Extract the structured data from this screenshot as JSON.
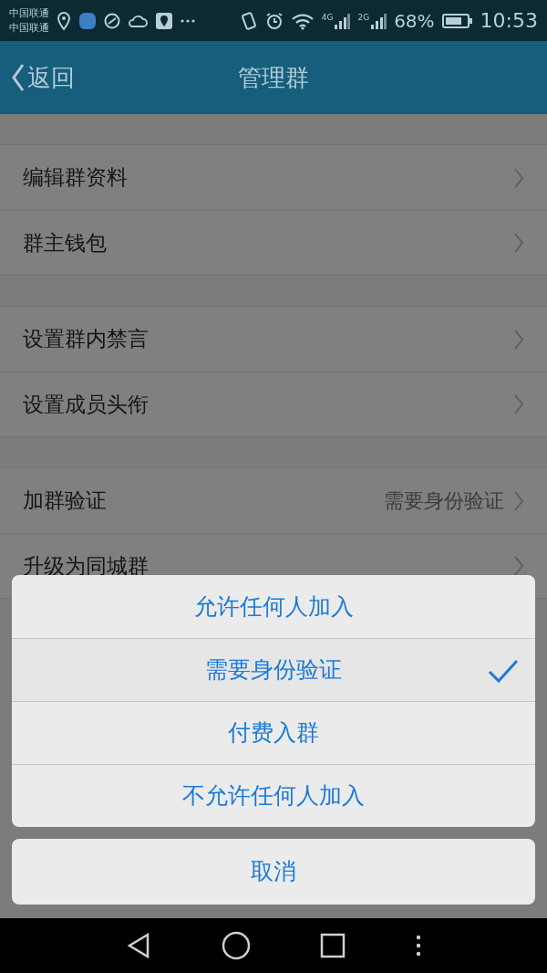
{
  "status_bar": {
    "carriers": [
      "中国联通",
      "中国联通"
    ],
    "network_labels": [
      "4G",
      "2G"
    ],
    "battery": "68%",
    "time": "10:53"
  },
  "header": {
    "back": "返回",
    "title": "管理群"
  },
  "groups": [
    {
      "rows": [
        {
          "label": "编辑群资料"
        },
        {
          "label": "群主钱包"
        }
      ]
    },
    {
      "rows": [
        {
          "label": "设置群内禁言"
        },
        {
          "label": "设置成员头衔"
        }
      ]
    },
    {
      "rows": [
        {
          "label": "加群验证",
          "value": "需要身份验证"
        },
        {
          "label": "升级为同城群"
        }
      ]
    }
  ],
  "action_sheet": {
    "options": [
      {
        "label": "允许任何人加入",
        "selected": false
      },
      {
        "label": "需要身份验证",
        "selected": true
      },
      {
        "label": "付费入群",
        "selected": false
      },
      {
        "label": "不允许任何人加入",
        "selected": false
      }
    ],
    "cancel": "取消"
  }
}
